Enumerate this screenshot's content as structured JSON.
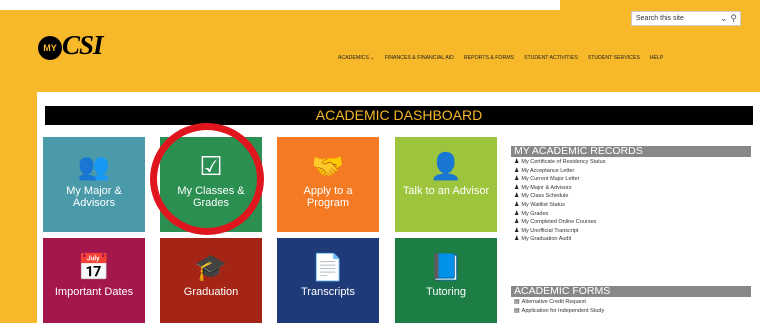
{
  "header": {
    "logo_badge": "MY",
    "logo_text": "CSI",
    "search_placeholder": "Search this site",
    "search_icon": "magnifier-icon",
    "nav": [
      "ACADEMICS ⌄",
      "FINANCES & FINANCIAL AID",
      "REPORTS & FORMS",
      "STUDENT ACTIVITIES",
      "STUDENT SERVICES",
      "HELP"
    ]
  },
  "dashboard": {
    "title": "ACADEMIC DASHBOARD",
    "tiles": [
      {
        "label": "My Major & Advisors",
        "icon": "group-icon",
        "glyph": "👥",
        "color": "#4a9aa9"
      },
      {
        "label": "My Classes & Grades",
        "icon": "checkbox-icon",
        "glyph": "☑",
        "color": "#2a8f51"
      },
      {
        "label": "Apply to a Program",
        "icon": "handshake-icon",
        "glyph": "🤝",
        "color": "#f47a24"
      },
      {
        "label": "Talk to an Advisor",
        "icon": "person-icon",
        "glyph": "👤",
        "color": "#9cc43c"
      },
      {
        "label": "Important Dates",
        "icon": "calendar-icon",
        "glyph": "📅",
        "color": "#a4174d"
      },
      {
        "label": "Graduation",
        "icon": "graduation-cap-icon",
        "glyph": "🎓",
        "color": "#a42416"
      },
      {
        "label": "Transcripts",
        "icon": "document-icon",
        "glyph": "📄",
        "color": "#1e3a78"
      },
      {
        "label": "Tutoring",
        "icon": "book-icon",
        "glyph": "📘",
        "color": "#1c7d45"
      }
    ]
  },
  "records": {
    "title": "MY ACADEMIC RECORDS",
    "items": [
      "My Certificate of Residency Status",
      "My Acceptance Letter",
      "My Current Major Letter",
      "My Major & Advisors",
      "My Class Schedule",
      "My Waitlist Status",
      "My Grades",
      "My Completed Online Courses",
      "My Unofficial Transcript",
      "My Graduation Audit"
    ]
  },
  "forms": {
    "title": "ACADEMIC FORMS",
    "items": [
      "Alternative Credit Request",
      "Application for Independent Study"
    ]
  }
}
